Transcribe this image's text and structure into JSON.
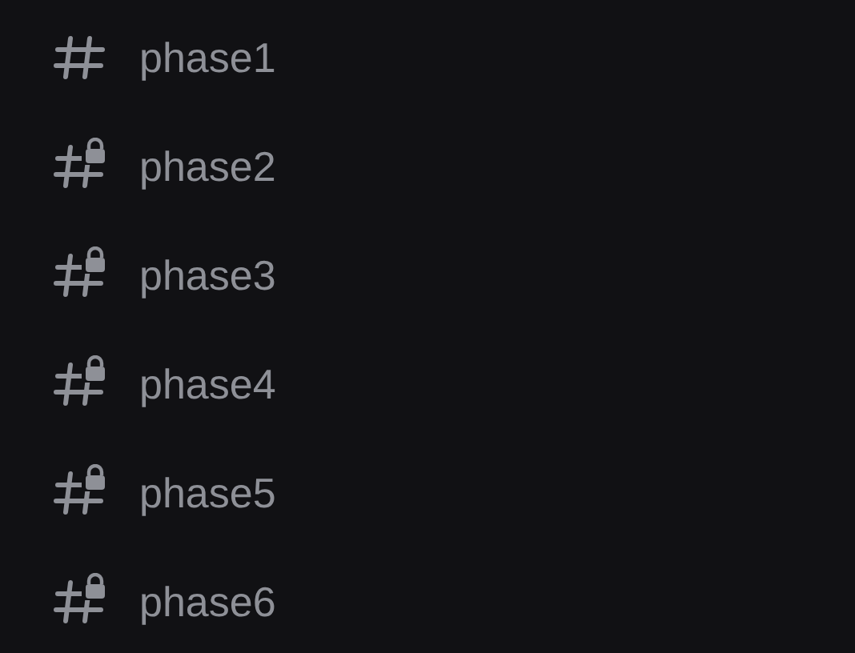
{
  "channels": [
    {
      "name": "phase1",
      "locked": false
    },
    {
      "name": "phase2",
      "locked": true
    },
    {
      "name": "phase3",
      "locked": true
    },
    {
      "name": "phase4",
      "locked": true
    },
    {
      "name": "phase5",
      "locked": true
    },
    {
      "name": "phase6",
      "locked": true
    }
  ]
}
